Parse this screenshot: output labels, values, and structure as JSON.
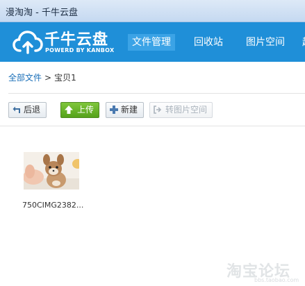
{
  "window": {
    "title": "漫淘淘 - 千牛云盘"
  },
  "header": {
    "logo_name": "千牛云盘",
    "logo_sub": "POWERD BY KANBOX",
    "nav": [
      {
        "label": "文件管理",
        "active": true
      },
      {
        "label": "回收站",
        "active": false
      },
      {
        "label": "图片空间",
        "active": false
      },
      {
        "label": "起",
        "active": false
      }
    ]
  },
  "breadcrumb": {
    "root": "全部文件",
    "separator": ">",
    "current": "宝贝1"
  },
  "toolbar": {
    "back_label": "后退",
    "upload_label": "上传",
    "new_label": "新建",
    "transfer_label": "转图片空间"
  },
  "files": [
    {
      "name": "750CIMG2382...",
      "type": "image"
    }
  ],
  "watermark": {
    "big": "淘宝论坛",
    "small": "bbs.taobao.com"
  },
  "colors": {
    "header": "#1f8fd8",
    "nav_active": "#3ba3e6",
    "upload": "#55a21b",
    "link": "#1a6fb8"
  }
}
